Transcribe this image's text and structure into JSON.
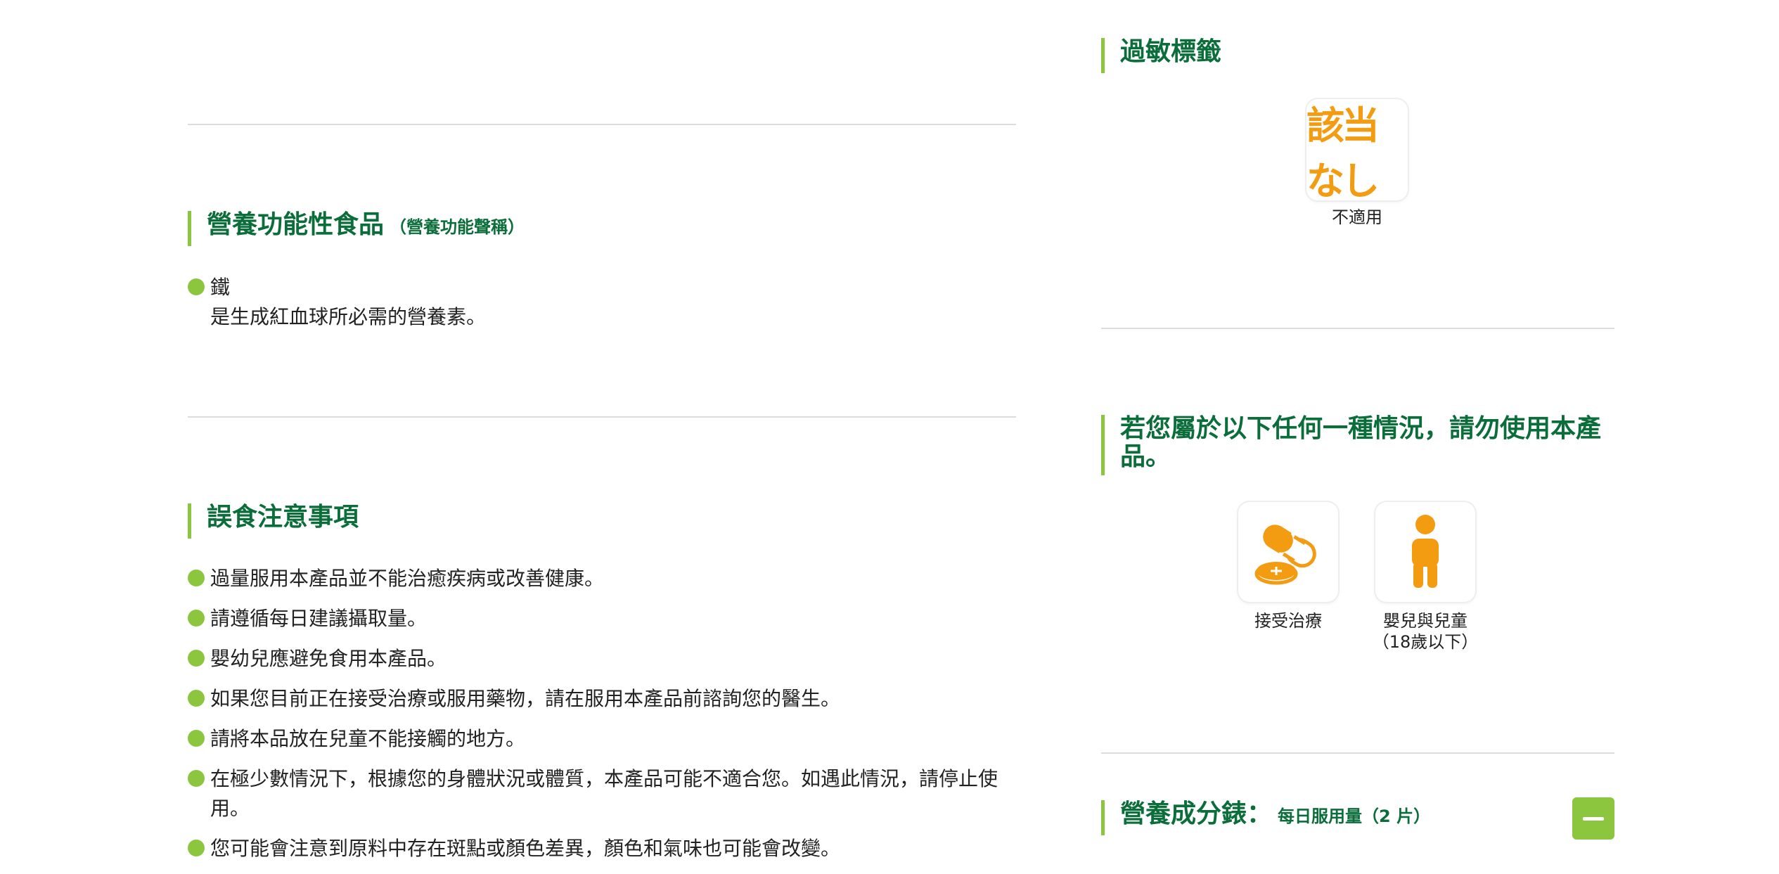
{
  "nutrient_claim": {
    "title": "營養功能性食品",
    "subtitle": "（營養功能聲稱）",
    "items": [
      {
        "name": "鐵",
        "desc": "是生成紅血球所必需的營養素。"
      }
    ]
  },
  "caution": {
    "title": "誤食注意事項",
    "items": [
      "過量服用本產品並不能治癒疾病或改善健康。",
      "請遵循每日建議攝取量。",
      "嬰幼兒應避免食用本產品。",
      "如果您目前正在接受治療或服用藥物，請在服用本產品前諮詢您的醫生。",
      "請將本品放在兒童不能接觸的地方。",
      "在極少數情況下，根據您的身體狀況或體質，本產品可能不適合您。如遇此情況，請停止使用。",
      "您可能會注意到原料中存在斑點或顏色差異，顏色和氣味也可能會改變。"
    ]
  },
  "allergy": {
    "title": "過敏標籤",
    "stamp_text": "該当なし",
    "label": "不適用"
  },
  "contraindication": {
    "title": "若您屬於以下任何一種情況，請勿使用本產品。",
    "items": [
      {
        "icon": "medication-icon",
        "label": "接受治療"
      },
      {
        "icon": "child-icon",
        "label": "嬰兒與兒童",
        "sub": "（18歲以下）"
      }
    ]
  },
  "nutrition": {
    "title": "營養成分錶：",
    "subtitle": "每日服用量（2 片）"
  },
  "colors": {
    "accent_green": "#8cc63f",
    "title_green": "#0b6e3a",
    "icon_orange": "#f39c12"
  }
}
